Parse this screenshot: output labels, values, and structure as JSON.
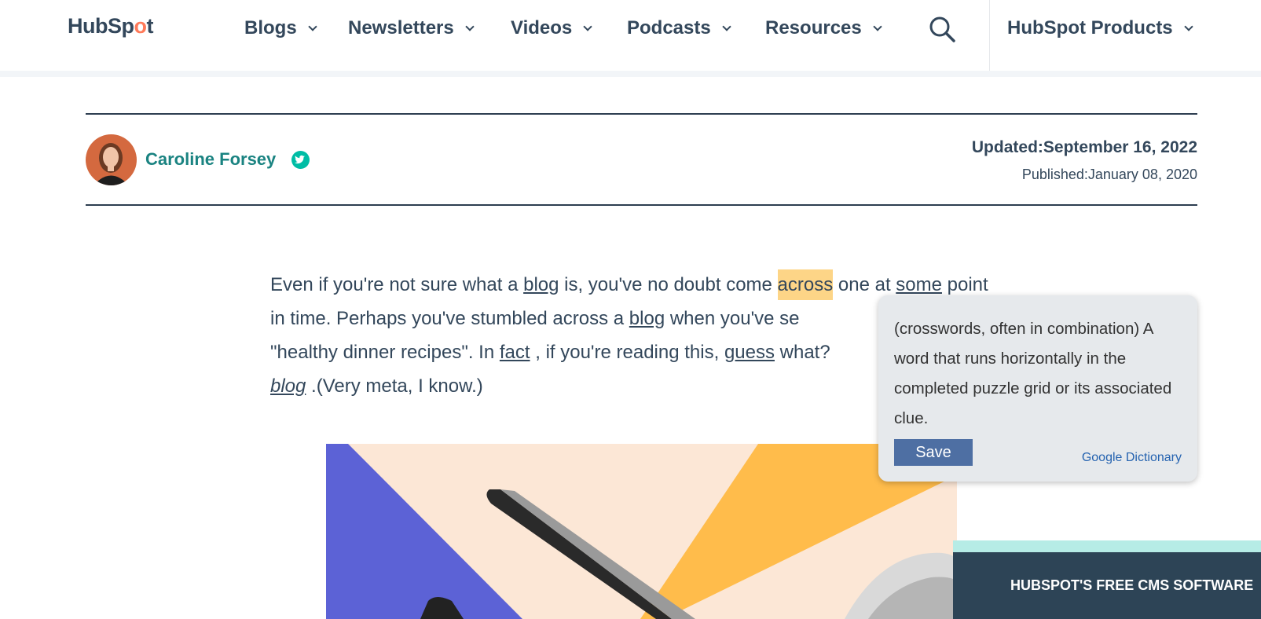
{
  "header": {
    "logo_text_a": "HubSp",
    "logo_text_o": "o",
    "logo_text_b": "t",
    "nav": [
      {
        "label": "Blogs"
      },
      {
        "label": "Newsletters"
      },
      {
        "label": "Videos"
      },
      {
        "label": "Podcasts"
      },
      {
        "label": "Resources"
      }
    ],
    "products_label": "HubSpot Products"
  },
  "author": {
    "name": "Caroline Forsey",
    "updated": "Updated:September 16, 2022",
    "published": "Published:January 08, 2020"
  },
  "article": {
    "t1": "Even if you're not sure what a ",
    "l1": "blog",
    "t2": " is, you've no doubt come ",
    "highlight": "across",
    "t3": " one at ",
    "l2": "some",
    "t4": " point in time. Perhaps you've stumbled across a ",
    "l3": "blog",
    "t5": " when you've se",
    "t6": "\"healthy dinner recipes\". In ",
    "l4": "fact",
    "t7": " , if you're reading this, ",
    "l5": "guess",
    "t8": " what?",
    "l6": "blog",
    "t9": " .(Very meta, I know.)"
  },
  "dictionary_popup": {
    "definition": "(crosswords, often in combination) A word that runs horizontally in the completed puzzle grid or its associated clue.",
    "save_label": "Save",
    "source_label": "Google Dictionary"
  },
  "cms_banner": {
    "label": "HUBSPOT'S FREE CMS SOFTWARE"
  },
  "colors": {
    "brand_orange": "#ff7a59",
    "author_teal": "#1a8381",
    "highlight": "#fdd587",
    "popup_bg": "#e6e9ec",
    "save_button": "#4e6fa3",
    "banner_dark": "#2d4456"
  },
  "icons": {
    "search": "search-icon",
    "twitter": "twitter-icon",
    "chevron": "chevron-down-icon"
  }
}
